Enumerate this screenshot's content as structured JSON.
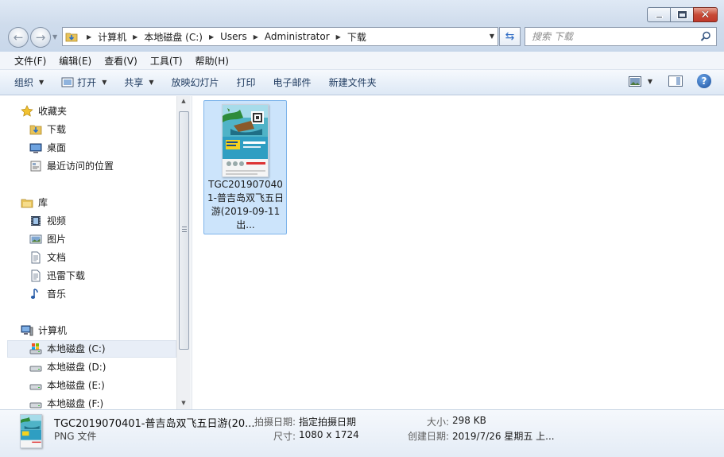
{
  "address": {
    "crumbs": [
      "计算机",
      "本地磁盘 (C:)",
      "Users",
      "Administrator",
      "下载"
    ]
  },
  "search": {
    "placeholder": "搜索 下载"
  },
  "menu": [
    "文件(F)",
    "编辑(E)",
    "查看(V)",
    "工具(T)",
    "帮助(H)"
  ],
  "toolbar": {
    "organize": "组织",
    "open": "打开",
    "share": "共享",
    "slideshow": "放映幻灯片",
    "print": "打印",
    "email": "电子邮件",
    "new_folder": "新建文件夹"
  },
  "nav": {
    "favorites": {
      "label": "收藏夹",
      "items": [
        "下载",
        "桌面",
        "最近访问的位置"
      ]
    },
    "libraries": {
      "label": "库",
      "items": [
        "视频",
        "图片",
        "文档",
        "迅雷下载",
        "音乐"
      ]
    },
    "computer": {
      "label": "计算机",
      "items": [
        "本地磁盘 (C:)",
        "本地磁盘 (D:)",
        "本地磁盘 (E:)",
        "本地磁盘 (F:)"
      ]
    }
  },
  "file": {
    "name_display": "TGC2019070401-普吉岛双飞五日游(2019-09-11出..."
  },
  "details": {
    "name": "TGC2019070401-普吉岛双飞五日游(20...",
    "type": "PNG 文件",
    "shot_date_label": "拍摄日期:",
    "shot_date_value": "指定拍摄日期",
    "dimensions_label": "尺寸:",
    "dimensions_value": "1080 x 1724",
    "size_label": "大小:",
    "size_value": "298 KB",
    "created_label": "创建日期:",
    "created_value": "2019/7/26 星期五 上..."
  },
  "colors": {
    "selection": "#cce4fb",
    "selection_border": "#7eb4ea",
    "toolbar_text": "#1e3a5f"
  }
}
